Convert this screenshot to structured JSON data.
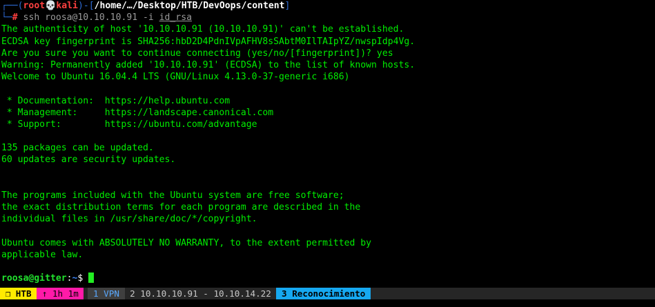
{
  "prompt": {
    "corner_top": "┌──(",
    "user": "root",
    "skull": "💀",
    "host": "kali",
    "dir_sep_open": ")-[",
    "path": "/home/…/Desktop/HTB/DevOops/content",
    "dir_sep_close": "]",
    "corner_bottom": "└─",
    "hash": "#",
    "cmd_prefix": " ssh roosa@10.10.10.91 ",
    "cmd_flag": "-i",
    "cmd_space": " ",
    "cmd_keyfile": "id_rsa"
  },
  "output_lines": [
    "The authenticity of host '10.10.10.91 (10.10.10.91)' can't be established.",
    "ECDSA key fingerprint is SHA256:hbD2D4PdnIVpAFHV8sSAbtM0IlTAIpYZ/nwspIdp4Vg.",
    "Are you sure you want to continue connecting (yes/no/[fingerprint])? yes",
    "Warning: Permanently added '10.10.10.91' (ECDSA) to the list of known hosts.",
    "Welcome to Ubuntu 16.04.4 LTS (GNU/Linux 4.13.0-37-generic i686)",
    "",
    " * Documentation:  https://help.ubuntu.com",
    " * Management:     https://landscape.canonical.com",
    " * Support:        https://ubuntu.com/advantage",
    "",
    "135 packages can be updated.",
    "60 updates are security updates.",
    "",
    "",
    "The programs included with the Ubuntu system are free software;",
    "the exact distribution terms for each program are described in the",
    "individual files in /usr/share/doc/*/copyright.",
    "",
    "Ubuntu comes with ABSOLUTELY NO WARRANTY, to the extent permitted by",
    "applicable law.",
    ""
  ],
  "remote_prompt": {
    "user_host": "roosa@gitter",
    "sep": ":",
    "path": "~",
    "symbol": "$ "
  },
  "statusbar": {
    "session_icon": "❐",
    "session": "HTB",
    "uptime_icon": "↑",
    "uptime": "1h 1m",
    "window1": "1 VPN",
    "window2": "2 10.10.10.91 - 10.10.14.22",
    "window3": "3 Reconocimiento"
  }
}
